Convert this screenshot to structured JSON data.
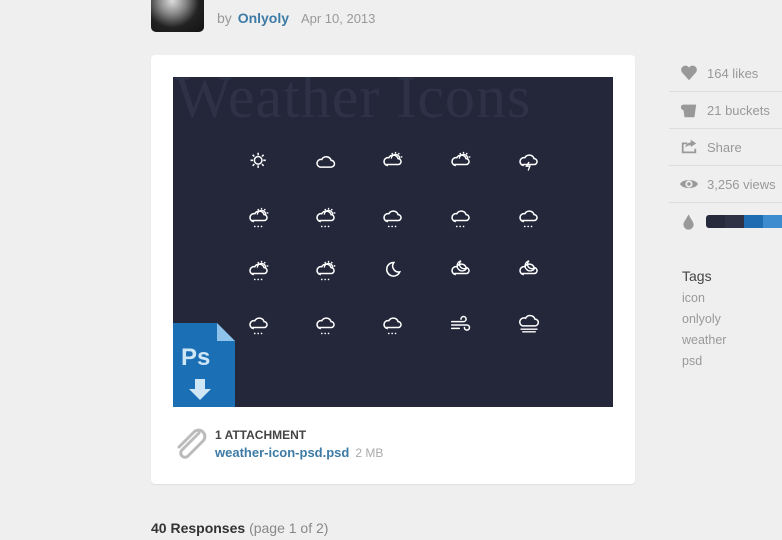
{
  "byline": {
    "prefix": "by",
    "author": "Onlyoly",
    "date": "Apr 10, 2013"
  },
  "shot": {
    "watermark": "Weather Icons",
    "background": "#24273a",
    "icons": [
      [
        "sun",
        "cloud",
        "sun-cloud",
        "sun-cloud-partly",
        "cloud-lightning"
      ],
      [
        "sun-cloud-rain",
        "sun-cloud-heavy-rain",
        "cloud-drizzle",
        "cloud-rain",
        "cloud-snow"
      ],
      [
        "sun-cloud-snow",
        "sun-cloud-snow-heavy",
        "moon",
        "moon-cloud",
        "moon-cloud-partly"
      ],
      [
        "cloud-drizzle-light",
        "cloud-hail",
        "cloud-hail-heavy",
        "wind",
        "fog"
      ]
    ],
    "badge": "Ps"
  },
  "attachment": {
    "title": "1 ATTACHMENT",
    "file": "weather-icon-psd.psd",
    "size": "2 MB"
  },
  "stats": [
    {
      "icon": "heart-icon",
      "label": "164 likes"
    },
    {
      "icon": "bucket-icon",
      "label": "21 buckets"
    },
    {
      "icon": "share-icon",
      "label": "Share"
    },
    {
      "icon": "eye-icon",
      "label": "3,256 views"
    }
  ],
  "palette": [
    "#262a3b",
    "#2e3244",
    "#1f6cb3",
    "#3c8ccf"
  ],
  "tags": {
    "title": "Tags",
    "items": [
      "icon",
      "onlyoly",
      "weather",
      "psd"
    ]
  },
  "responses": {
    "count": "40 Responses",
    "page": "(page 1 of 2)"
  }
}
